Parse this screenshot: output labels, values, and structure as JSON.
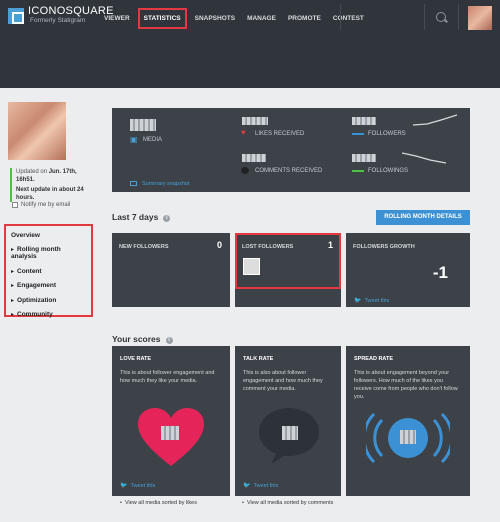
{
  "header": {
    "logo_title": "ICONOSQUARE",
    "logo_subtitle": "Formerly Statigram",
    "nav": [
      "VIEWER",
      "STATISTICS",
      "SNAPSHOTS",
      "MANAGE",
      "PROMOTE",
      "CONTEST"
    ],
    "active_nav": "STATISTICS"
  },
  "profile": {
    "updated_prefix": "Updated on",
    "updated_value": "Jun. 17th, 16h51.",
    "next_update": "Next update in about 24 hours.",
    "notify_label": "Notify me by email"
  },
  "side_menu": {
    "overview": "Overview",
    "items": [
      "Rolling month analysis",
      "Content",
      "Engagement",
      "Optimization",
      "Community"
    ]
  },
  "summary": {
    "media_label": "MEDIA",
    "likes_label": "LIKES RECEIVED",
    "comments_label": "COMMENTS RECEIVED",
    "followers_label": "FOLLOWERS",
    "followings_label": "FOLLOWINGS",
    "snapshot_link": "Summary snapshot"
  },
  "last7": {
    "title": "Last 7 days",
    "button": "ROLLING MONTH DETAILS",
    "new_followers_label": "NEW FOLLOWERS",
    "new_followers_value": "0",
    "lost_followers_label": "LOST FOLLOWERS",
    "lost_followers_value": "1",
    "growth_label": "FOLLOWERS GROWTH",
    "growth_value": "-1",
    "tweet": "Tweet this"
  },
  "scores": {
    "title": "Your scores",
    "cards": [
      {
        "title": "LOVE RATE",
        "desc": "This is about follower engagement and how much they like your media.",
        "tweet": "Tweet this",
        "view_all": "View all media sorted by likes",
        "color": "#e5245a"
      },
      {
        "title": "TALK RATE",
        "desc": "This is also about follower engagement and how much they comment your media.",
        "tweet": "Tweet this",
        "view_all": "View all media sorted by comments",
        "color": "#2d3238"
      },
      {
        "title": "SPREAD RATE",
        "desc": "This is about engagement beyond your followers. How much of the likes you receive come from people who don't follow you.",
        "tweet": "",
        "view_all": "",
        "color": "#3b91d4"
      }
    ]
  }
}
